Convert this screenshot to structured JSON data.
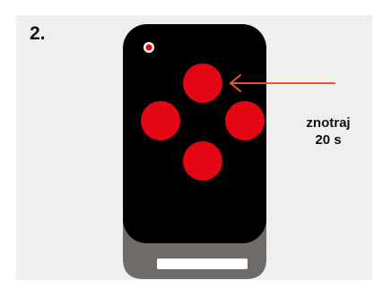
{
  "step": {
    "number": "2."
  },
  "note": {
    "line1": "znotraj",
    "line2": "20 s"
  },
  "colors": {
    "panel": "#efefef",
    "remote_body": "#000000",
    "remote_base": "#6f6b68",
    "button": "#e30613",
    "led": "#e30613",
    "arrow": "#e35a1f",
    "slot": "#ffffff"
  },
  "remote": {
    "buttons": [
      "top",
      "left",
      "right",
      "bottom"
    ],
    "highlighted_button": "top",
    "led": "status-led"
  }
}
